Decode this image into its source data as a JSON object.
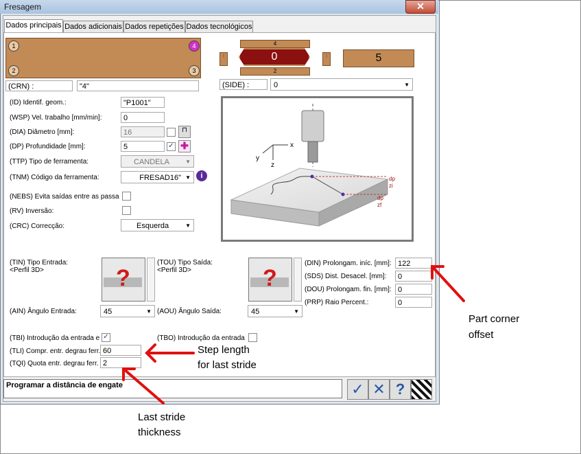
{
  "window": {
    "title": "Fresagem",
    "close": "✕"
  },
  "tabs": [
    {
      "label": "Dados principais"
    },
    {
      "label": "Dados adicionais"
    },
    {
      "label": "Dados repetições"
    },
    {
      "label": "Dados tecnológicos"
    }
  ],
  "piece": {
    "corners": [
      "1",
      "4",
      "2",
      "3"
    ]
  },
  "side_panel": {
    "top": "4",
    "value": "0",
    "bottom": "2",
    "count": "5"
  },
  "crn": {
    "label": "(CRN) :",
    "value": "\"4\""
  },
  "side": {
    "label": "(SIDE) :",
    "value": "0"
  },
  "form": [
    {
      "label": "(ID) Identif. geom.:",
      "value": "\"P1001\""
    },
    {
      "label": "(WSP) Vel. trabalho [mm/min]:",
      "value": "0"
    },
    {
      "label": "(DIA) Diâmetro [mm]:",
      "value": "16"
    },
    {
      "label": "(DP) Profundidade [mm]:",
      "value": "5"
    },
    {
      "label": "(TTP) Tipo de ferramenta:",
      "value": "CANDELA"
    },
    {
      "label": "(TNM) Código da ferramenta:",
      "value": "FRESAD16\""
    },
    {
      "label": "(NEBS) Evita saídas entre as passa"
    },
    {
      "label": "(RV) Inversão:"
    },
    {
      "label": "(CRC) Correcção:",
      "value": "Esquerda"
    }
  ],
  "illustration": {
    "x": "x",
    "y": "y",
    "z": "z",
    "dp": "dp",
    "zi": "zi",
    "zf": "zf"
  },
  "entry": {
    "tin_label": "(TIN) Tipo Entrada:",
    "tin_value": "<Perfil 3D>",
    "tou_label": "(TOU) Tipo Saída:",
    "tou_value": "<Perfil 3D>",
    "ain_label": "(AIN) Ângulo Entrada:",
    "ain_value": "45",
    "aou_label": "(AOU) Ângulo Saída:",
    "aou_value": "45"
  },
  "right_fields": [
    {
      "label": "(DIN) Prolongam. iníc. [mm]:",
      "value": "122"
    },
    {
      "label": "(SDS) Dist. Desacel. [mm]:",
      "value": "0"
    },
    {
      "label": "(DOU) Prolongam. fin. [mm]:",
      "value": "0"
    },
    {
      "label": "(PRP) Raio Percent.:",
      "value": "0"
    }
  ],
  "bottom": {
    "tbi_label": "(TBI) Introdução da entrada e",
    "tbo_label": "(TBO) Introdução da entrada",
    "tli_label": "(TLI) Compr. entr. degrau ferr.",
    "tli_value": "60",
    "tqi_label": "(TQI) Quota entr. degrau ferr.",
    "tqi_value": "2"
  },
  "status_text": "Programar a distância de engate",
  "annotations": {
    "part_corner": "Part corner\noffset",
    "step_length": "Step length\nfor last stride",
    "last_stride": "Last stride\nthickness"
  },
  "colors": {
    "arrow": "#e01010",
    "piece": "#c28a55",
    "selector": "#8b1010"
  }
}
